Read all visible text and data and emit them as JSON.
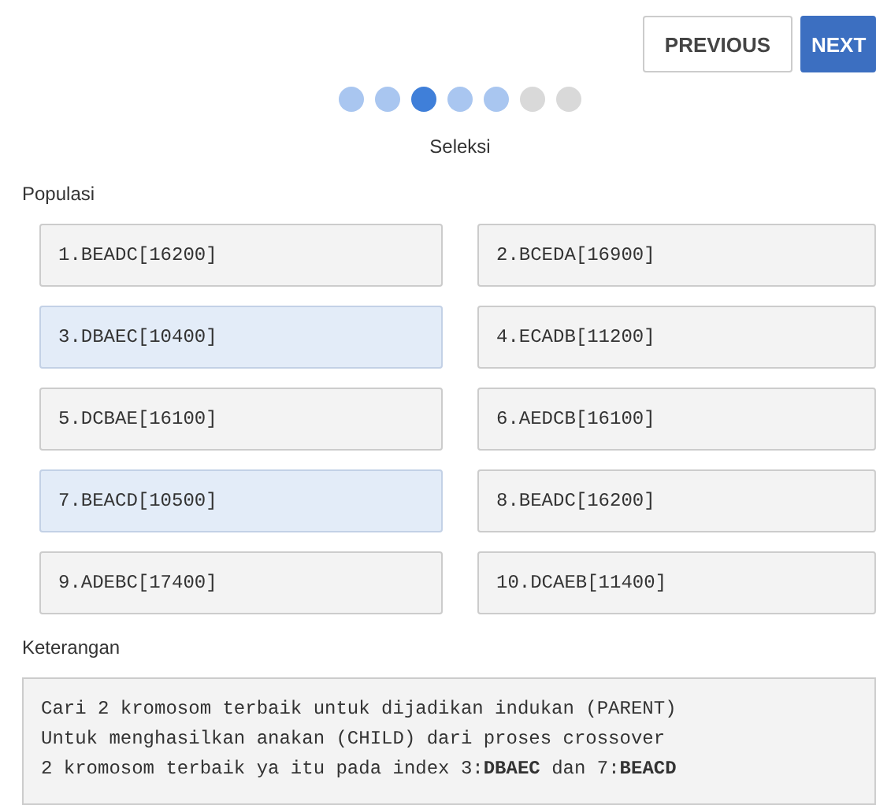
{
  "buttons": [
    {
      "label": "PREVIOUS",
      "kind": "secondary"
    },
    {
      "label": "NEXT",
      "kind": "primary"
    }
  ],
  "steps": [
    {
      "done": true,
      "selected": false
    },
    {
      "done": true,
      "selected": false
    },
    {
      "done": false,
      "selected": true
    },
    {
      "done": true,
      "selected": false
    },
    {
      "done": true,
      "selected": false
    },
    {
      "done": false,
      "selected": false
    },
    {
      "done": false,
      "selected": false
    }
  ],
  "step_title": "Seleksi",
  "population": {
    "label": "Populasi",
    "items": [
      {
        "text": "1.BEADC[16200]",
        "selected": false
      },
      {
        "text": "2.BCEDA[16900]",
        "selected": false
      },
      {
        "text": "3.DBAEC[10400]",
        "selected": true
      },
      {
        "text": "4.ECADB[11200]",
        "selected": false
      },
      {
        "text": "5.DCBAE[16100]",
        "selected": false
      },
      {
        "text": "6.AEDCB[16100]",
        "selected": false
      },
      {
        "text": "7.BEACD[10500]",
        "selected": true
      },
      {
        "text": "8.BEADC[16200]",
        "selected": false
      },
      {
        "text": "9.ADEBC[17400]",
        "selected": false
      },
      {
        "text": "10.DCAEB[11400]",
        "selected": false
      }
    ]
  },
  "description": {
    "label": "Keterangan",
    "lines": [
      "Cari 2 kromosom terbaik untuk dijadikan indukan (PARENT)",
      "Untuk menghasilkan anakan (CHILD) dari proses crossover",
      "2 kromosom terbaik ya itu pada index 3:**DBAEC** dan 7:**BEACD**"
    ]
  }
}
